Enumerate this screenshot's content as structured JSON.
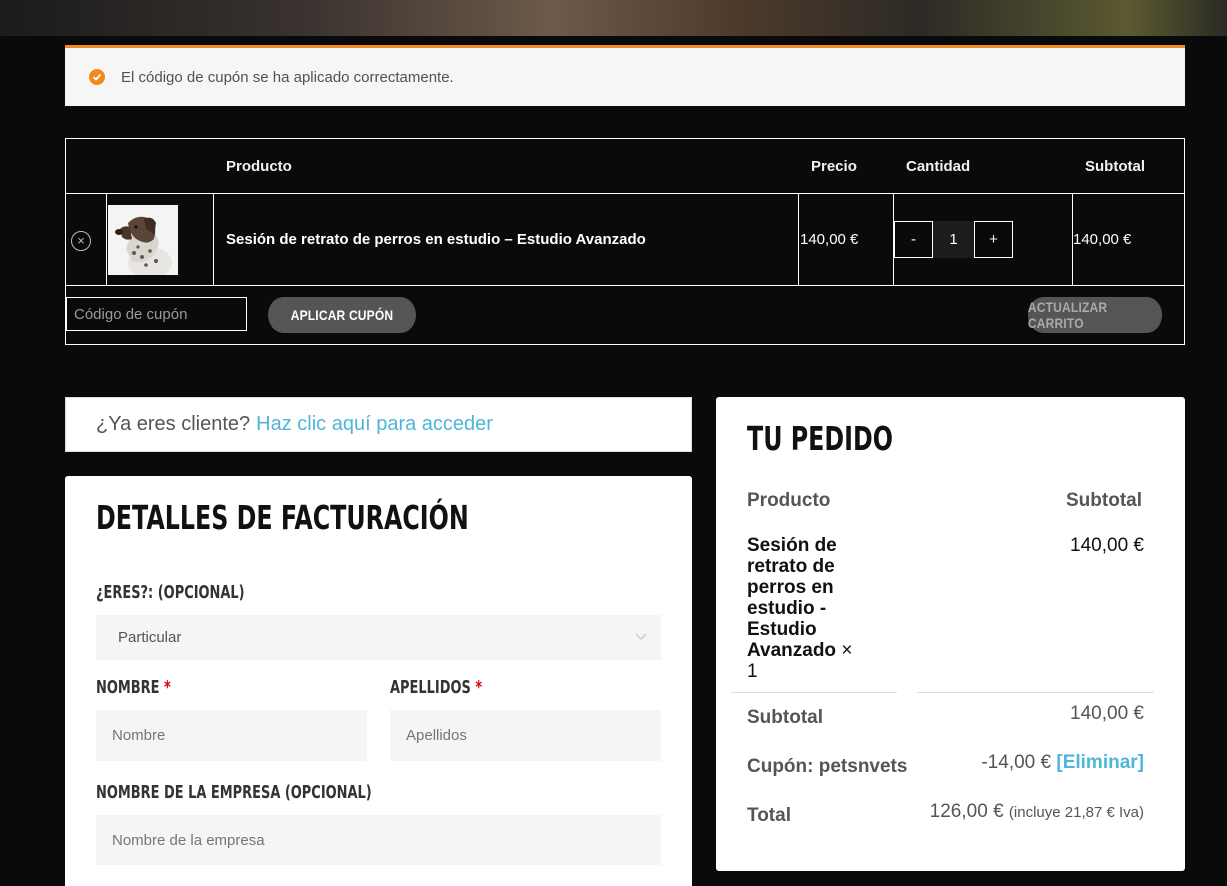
{
  "notice": {
    "message": "El código de cupón se ha aplicado correctamente."
  },
  "cart": {
    "headers": {
      "product": "Producto",
      "price": "Precio",
      "quantity": "Cantidad",
      "subtotal": "Subtotal"
    },
    "item": {
      "name": "Sesión de retrato de perros en estudio – Estudio Avanzado",
      "price": "140,00 €",
      "quantity": "1",
      "minus": "-",
      "plus": "+",
      "subtotal": "140,00 €"
    },
    "coupon_placeholder": "Código de cupón",
    "apply_label": "APLICAR CUPÓN",
    "update_label": "ACTUALIZAR CARRITO"
  },
  "login": {
    "prompt": "¿Ya eres cliente?",
    "link": "Haz clic aquí para acceder"
  },
  "billing": {
    "title": "DETALLES DE FACTURACIÓN",
    "type_label": "¿ERES?: (OPCIONAL)",
    "type_value": "Particular",
    "first_name_label": "NOMBRE",
    "first_name_placeholder": "Nombre",
    "last_name_label": "APELLIDOS",
    "last_name_placeholder": "Apellidos",
    "company_label": "NOMBRE DE LA EMPRESA (OPCIONAL)",
    "company_placeholder": "Nombre de la empresa",
    "required_mark": "*"
  },
  "order": {
    "title": "TU PEDIDO",
    "col_product": "Producto",
    "col_subtotal": "Subtotal",
    "item_name": "Sesión de retrato de perros en estudio - Estudio Avanzado",
    "item_qty": "× 1",
    "item_price": "140,00 €",
    "subtotal_label": "Subtotal",
    "subtotal_value": "140,00 €",
    "coupon_label": "Cupón: petsnvets",
    "coupon_value": "-14,00 €",
    "coupon_remove": "[Eliminar]",
    "total_label": "Total",
    "total_value": "126,00 €",
    "total_note": "(incluye 21,87 € Iva)"
  },
  "colors": {
    "accent": "#f08a1c",
    "link": "#4fb6d9",
    "button": "#555555",
    "background": "#0a0a0a"
  }
}
